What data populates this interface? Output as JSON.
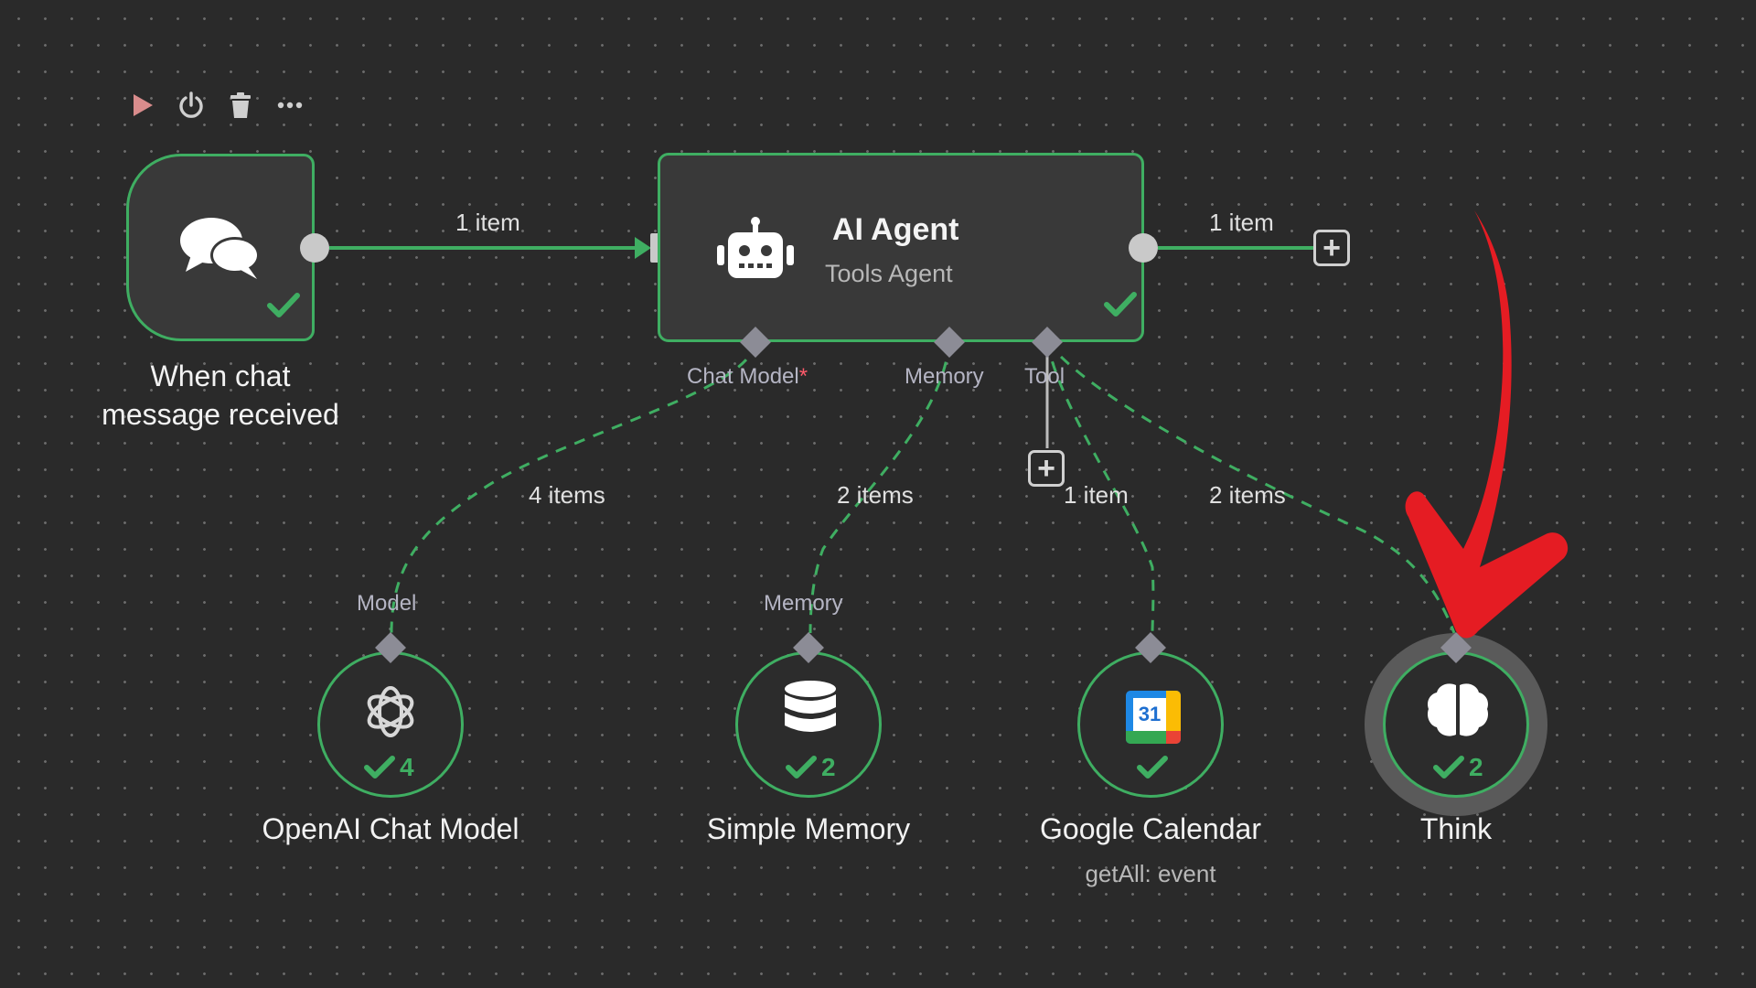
{
  "toolbar": {
    "icons": [
      "play-icon",
      "power-icon",
      "trash-icon",
      "more-icon"
    ]
  },
  "nodes": {
    "trigger": {
      "name": "When chat message received"
    },
    "agent": {
      "title": "AI Agent",
      "subtitle": "Tools Agent",
      "ports": {
        "chat_model": "Chat Model",
        "chat_model_required": "*",
        "memory": "Memory",
        "tool": "Tool"
      }
    },
    "openai": {
      "name": "OpenAI Chat Model",
      "port": "Model",
      "count": "4"
    },
    "memory": {
      "name": "Simple Memory",
      "port": "Memory",
      "count": "2"
    },
    "calendar": {
      "name": "Google Calendar",
      "subtitle": "getAll: event",
      "icon_text": "31"
    },
    "think": {
      "name": "Think",
      "count": "2"
    }
  },
  "connections": {
    "trigger_to_agent": "1 item",
    "agent_output": "1 item",
    "model": "4 items",
    "memory": "2 items",
    "calendar": "1 item",
    "think": "2 items"
  },
  "colors": {
    "success": "#3fae62",
    "canvas": "#2a2a2a",
    "node": "#393939",
    "annotation_arrow": "#e51c23"
  }
}
